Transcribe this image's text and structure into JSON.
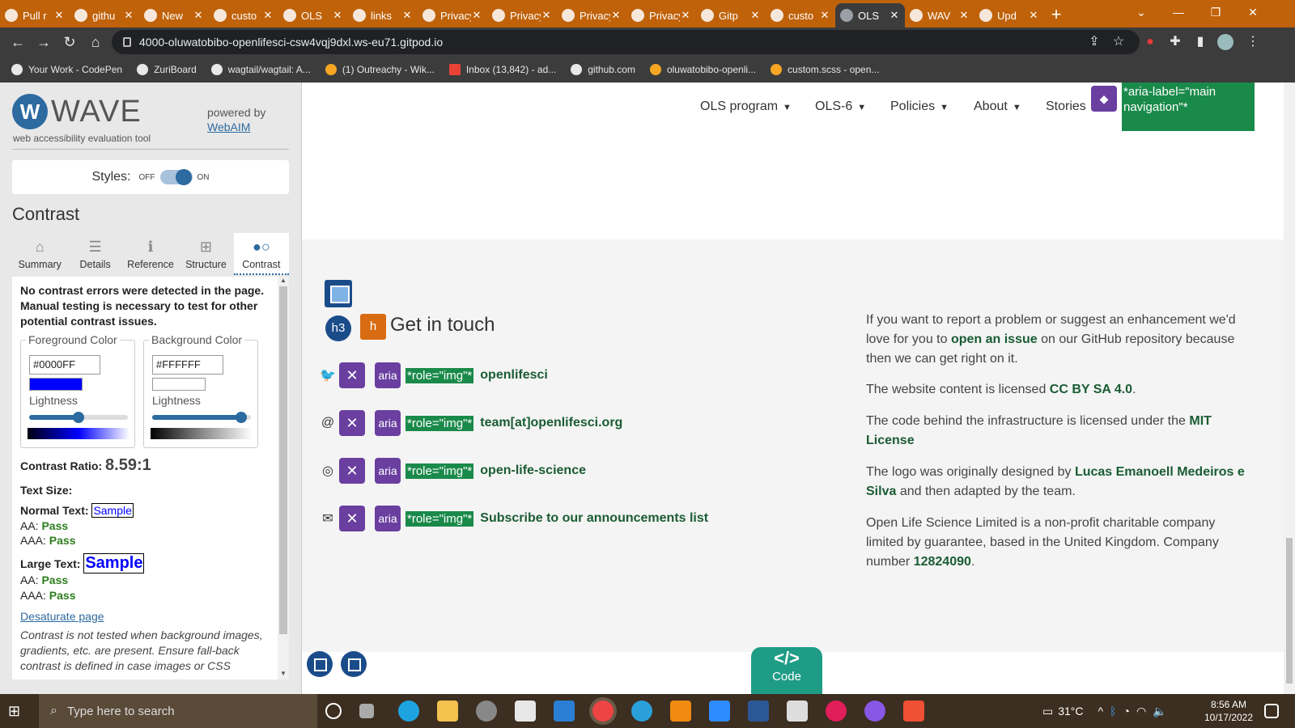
{
  "browser": {
    "tabs": [
      {
        "title": "Pull r",
        "active": false
      },
      {
        "title": "githu",
        "active": false
      },
      {
        "title": "New",
        "active": false
      },
      {
        "title": "custo",
        "active": false
      },
      {
        "title": "OLS",
        "active": false
      },
      {
        "title": "links",
        "active": false
      },
      {
        "title": "Privacy e",
        "active": false
      },
      {
        "title": "Privacy e",
        "active": false
      },
      {
        "title": "Privacy e",
        "active": false
      },
      {
        "title": "Privacy e",
        "active": false
      },
      {
        "title": "Gitp",
        "active": false
      },
      {
        "title": "custo",
        "active": false
      },
      {
        "title": "OLS",
        "active": true
      },
      {
        "title": "WAV",
        "active": false
      },
      {
        "title": "Upd",
        "active": false
      }
    ],
    "url": "4000-oluwatobibo-openlifesci-csw4vqj9dxl.ws-eu71.gitpod.io",
    "bookmarks": [
      {
        "label": "Your Work - CodePen",
        "icon": "codepen-icon"
      },
      {
        "label": "ZuriBoard",
        "icon": "globe-icon"
      },
      {
        "label": "wagtail/wagtail: A...",
        "icon": "github-icon"
      },
      {
        "label": "(1) Outreachy - Wik...",
        "icon": "outreachy-icon"
      },
      {
        "label": "Inbox (13,842) - ad...",
        "icon": "gmail-icon"
      },
      {
        "label": "github.com",
        "icon": "github-icon"
      },
      {
        "label": "oluwatobibo-openli...",
        "icon": "gitpod-icon"
      },
      {
        "label": "custom.scss - open...",
        "icon": "gitpod-icon"
      }
    ]
  },
  "wave": {
    "logo_letter": "W",
    "logo_word": "WAVE",
    "tagline": "web accessibility evaluation tool",
    "powered_by": "powered by",
    "powered_link": "WebAIM",
    "styles_label": "Styles:",
    "styles_off": "OFF",
    "styles_on": "ON",
    "panel_title": "Contrast",
    "tabs": [
      {
        "label": "Summary",
        "icon": "home-icon",
        "glyph": "⌂"
      },
      {
        "label": "Details",
        "icon": "list-icon",
        "glyph": "☰"
      },
      {
        "label": "Reference",
        "icon": "info-icon",
        "glyph": "ℹ"
      },
      {
        "label": "Structure",
        "icon": "structure-icon",
        "glyph": "⊞"
      },
      {
        "label": "Contrast",
        "icon": "contrast-icon",
        "glyph": "●○"
      }
    ],
    "message": "No contrast errors were detected in the page. Manual testing is necessary to test for other potential contrast issues.",
    "foreground": {
      "legend": "Foreground Color",
      "hex": "#0000FF",
      "lightness_label": "Lightness",
      "lightness": 0.5
    },
    "background": {
      "legend": "Background Color",
      "hex": "#FFFFFF",
      "lightness_label": "Lightness",
      "lightness": 0.9
    },
    "ratio_label": "Contrast Ratio:",
    "ratio_value": "8.59:1",
    "text_size_label": "Text Size:",
    "normal_label": "Normal Text:",
    "large_label": "Large Text:",
    "sample": "Sample",
    "aa_label": "AA:",
    "aaa_label": "AAA:",
    "normal_aa": "Pass",
    "normal_aaa": "Pass",
    "large_aa": "Pass",
    "large_aaa": "Pass",
    "desaturate": "Desaturate page",
    "note": "Contrast is not tested when background images, gradients, etc. are present. Ensure fall-back contrast is defined in case images or CSS"
  },
  "site": {
    "nav": [
      "OLS program",
      "OLS-6",
      "Policies",
      "About",
      "Stories"
    ],
    "aria_main": "*aria-label=\"main navigation\"*",
    "h3_badge": "h3",
    "h_badge": "h",
    "heading": "Get in touch",
    "aria_badge": "aria",
    "role_img": "*role=\"img\"*",
    "contacts": [
      {
        "icon": "twitter-icon",
        "glyph": "🐦",
        "text": "openlifesci"
      },
      {
        "icon": "at-icon",
        "glyph": "@",
        "text": "team[at]openlifesci.org"
      },
      {
        "icon": "github-icon",
        "glyph": "◎",
        "text": "open-life-science"
      },
      {
        "icon": "envelope-icon",
        "glyph": "✉",
        "text": "Subscribe to our announcements list"
      }
    ],
    "footer_para1_a": "If you want to report a problem or suggest an enhancement we'd love for you to",
    "footer_para1_link": "open an issue",
    "footer_para1_b": "on our GitHub repository because then we can get right on it.",
    "footer_para2_a": "The website content is licensed",
    "footer_para2_link": "CC BY SA 4.0",
    "footer_para3_a": "The code behind the infrastructure is licensed under the",
    "footer_para3_link": "MIT License",
    "footer_para4_a": "The logo was originally designed by",
    "footer_para4_link": "Lucas Emanoell Medeiros e Silva",
    "footer_para4_b": "and then adapted by the team.",
    "footer_para5_a": "Open Life Science Limited is a non-profit charitable company limited by guarantee, based in the United Kingdom. Company number",
    "footer_para5_link": "12824090",
    "code_glyph": "</>",
    "code_label": "Code"
  },
  "taskbar": {
    "search_placeholder": "Type here to search",
    "temperature": "31°C",
    "time": "8:56 AM",
    "date": "10/17/2022"
  }
}
